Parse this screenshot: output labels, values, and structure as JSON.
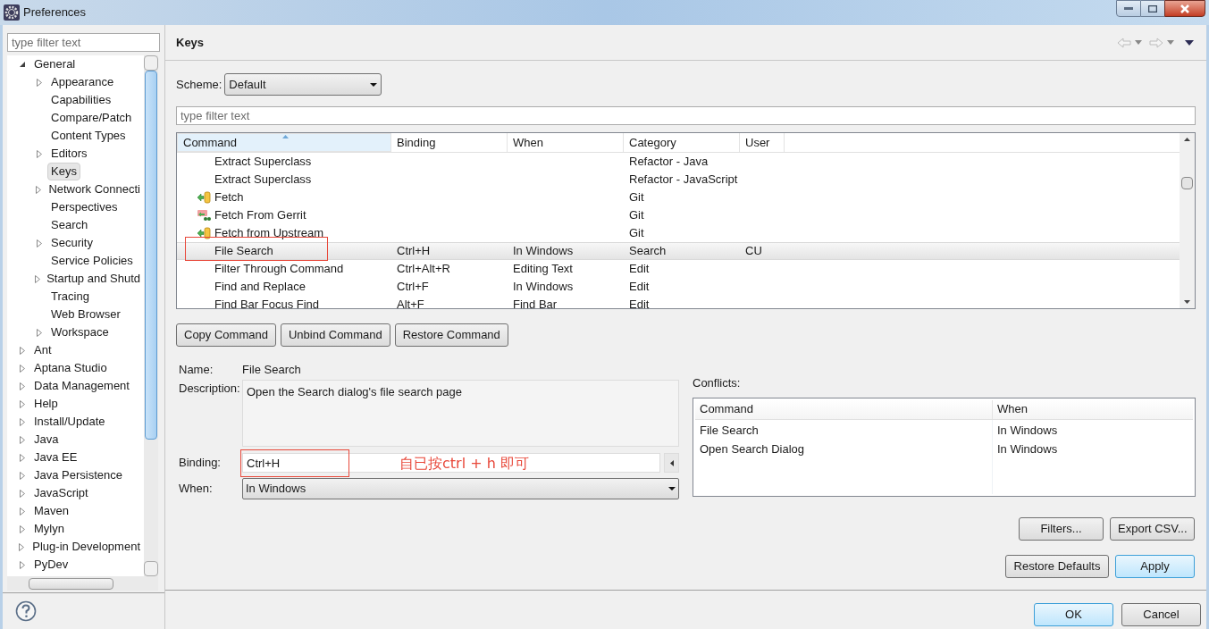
{
  "window": {
    "title": "Preferences"
  },
  "sidebar": {
    "filter_placeholder": "type filter text",
    "tree": [
      {
        "label": "General",
        "kind": "branch",
        "expanded": true,
        "selected": false,
        "children": [
          {
            "label": "Appearance",
            "kind": "branch",
            "expanded": false,
            "selected": false
          },
          {
            "label": "Capabilities",
            "kind": "leaf",
            "selected": false
          },
          {
            "label": "Compare/Patch",
            "kind": "leaf",
            "selected": false
          },
          {
            "label": "Content Types",
            "kind": "leaf",
            "selected": false
          },
          {
            "label": "Editors",
            "kind": "branch",
            "expanded": false,
            "selected": false
          },
          {
            "label": "Keys",
            "kind": "leaf",
            "selected": true
          },
          {
            "label": "Network Connecti",
            "kind": "branch",
            "expanded": false,
            "selected": false
          },
          {
            "label": "Perspectives",
            "kind": "leaf",
            "selected": false
          },
          {
            "label": "Search",
            "kind": "leaf",
            "selected": false
          },
          {
            "label": "Security",
            "kind": "branch",
            "expanded": false,
            "selected": false
          },
          {
            "label": "Service Policies",
            "kind": "leaf",
            "selected": false
          },
          {
            "label": "Startup and Shutd",
            "kind": "branch",
            "expanded": false,
            "selected": false
          },
          {
            "label": "Tracing",
            "kind": "leaf",
            "selected": false
          },
          {
            "label": "Web Browser",
            "kind": "leaf",
            "selected": false
          },
          {
            "label": "Workspace",
            "kind": "branch",
            "expanded": false,
            "selected": false
          }
        ]
      },
      {
        "label": "Ant",
        "kind": "branch",
        "expanded": false,
        "selected": false
      },
      {
        "label": "Aptana Studio",
        "kind": "branch",
        "expanded": false,
        "selected": false
      },
      {
        "label": "Data Management",
        "kind": "branch",
        "expanded": false,
        "selected": false
      },
      {
        "label": "Help",
        "kind": "branch",
        "expanded": false,
        "selected": false
      },
      {
        "label": "Install/Update",
        "kind": "branch",
        "expanded": false,
        "selected": false
      },
      {
        "label": "Java",
        "kind": "branch",
        "expanded": false,
        "selected": false
      },
      {
        "label": "Java EE",
        "kind": "branch",
        "expanded": false,
        "selected": false
      },
      {
        "label": "Java Persistence",
        "kind": "branch",
        "expanded": false,
        "selected": false
      },
      {
        "label": "JavaScript",
        "kind": "branch",
        "expanded": false,
        "selected": false
      },
      {
        "label": "Maven",
        "kind": "branch",
        "expanded": false,
        "selected": false
      },
      {
        "label": "Mylyn",
        "kind": "branch",
        "expanded": false,
        "selected": false
      },
      {
        "label": "Plug-in Development",
        "kind": "branch",
        "expanded": false,
        "selected": false
      },
      {
        "label": "PyDev",
        "kind": "branch",
        "expanded": false,
        "selected": false
      }
    ]
  },
  "page": {
    "title": "Keys",
    "scheme_label": "Scheme:",
    "scheme_value": "Default",
    "filter_placeholder": "type filter text",
    "table": {
      "columns": [
        "Command",
        "Binding",
        "When",
        "Category",
        "User"
      ],
      "rows": [
        {
          "kind": "plain",
          "command": "Extract Superclass",
          "binding": "",
          "when": "",
          "category": "Refactor - Java",
          "user": "",
          "selected": false
        },
        {
          "kind": "plain",
          "command": "Extract Superclass",
          "binding": "",
          "when": "",
          "category": "Refactor - JavaScript",
          "user": "",
          "selected": false
        },
        {
          "kind": "fetch",
          "command": "Fetch",
          "binding": "",
          "when": "",
          "category": "Git",
          "user": "",
          "selected": false
        },
        {
          "kind": "gerrit",
          "command": "Fetch From Gerrit",
          "binding": "",
          "when": "",
          "category": "Git",
          "user": "",
          "selected": false
        },
        {
          "kind": "fetch",
          "command": "Fetch from Upstream",
          "binding": "",
          "when": "",
          "category": "Git",
          "user": "",
          "selected": false
        },
        {
          "kind": "plain",
          "command": "File Search",
          "binding": "Ctrl+H",
          "when": "In Windows",
          "category": "Search",
          "user": "CU",
          "selected": true
        },
        {
          "kind": "plain",
          "command": "Filter Through Command",
          "binding": "Ctrl+Alt+R",
          "when": "Editing Text",
          "category": "Edit",
          "user": "",
          "selected": false
        },
        {
          "kind": "plain",
          "command": "Find and Replace",
          "binding": "Ctrl+F",
          "when": "In Windows",
          "category": "Edit",
          "user": "",
          "selected": false
        },
        {
          "kind": "plain",
          "command": "Find Bar Focus Find",
          "binding": "Alt+F",
          "when": "Find Bar",
          "category": "Edit",
          "user": "",
          "selected": false
        }
      ]
    },
    "command_buttons": [
      "Copy Command",
      "Unbind Command",
      "Restore Command"
    ],
    "name_label": "Name:",
    "name_value": "File Search",
    "description_label": "Description:",
    "description_value": "Open the Search dialog's file search page",
    "binding_label": "Binding:",
    "binding_value": "Ctrl+H",
    "annotation": "自已按ctrl + h 即可",
    "when_label": "When:",
    "when_value": "In Windows",
    "conflicts": {
      "label": "Conflicts:",
      "columns": [
        "Command",
        "When"
      ],
      "rows": [
        {
          "command": "File Search",
          "when": "In Windows"
        },
        {
          "command": "Open Search Dialog",
          "when": "In Windows"
        }
      ]
    },
    "side_buttons": [
      "Filters...",
      "Export CSV..."
    ],
    "page_buttons": [
      "Restore Defaults",
      "Apply"
    ]
  },
  "dialog_buttons": [
    "OK",
    "Cancel"
  ]
}
